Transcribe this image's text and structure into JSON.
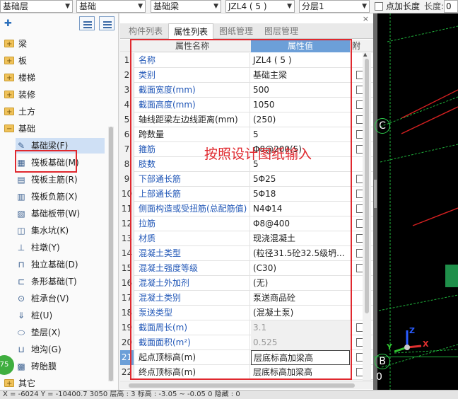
{
  "toolbar": {
    "floor_combo": "基础层",
    "category_combo": "基础",
    "type_combo": "基础梁",
    "member_combo": "JZL4 ( 5 )",
    "layer_combo": "分层1",
    "add_length_label": "点加长度",
    "length_label": "长度:",
    "length_value": "0"
  },
  "tree": {
    "items": [
      {
        "label": "梁",
        "kind": "folder"
      },
      {
        "label": "板",
        "kind": "folder"
      },
      {
        "label": "楼梯",
        "kind": "folder"
      },
      {
        "label": "装修",
        "kind": "folder"
      },
      {
        "label": "土方",
        "kind": "folder"
      },
      {
        "label": "基础",
        "kind": "folder-open"
      },
      {
        "label": "基础梁(F)",
        "kind": "leaf",
        "icon": "pencil-icon",
        "glyph": "✎",
        "selected": true
      },
      {
        "label": "筏板基础(M)",
        "kind": "leaf",
        "icon": "raft-slab-icon",
        "glyph": "▦"
      },
      {
        "label": "筏板主筋(R)",
        "kind": "leaf",
        "icon": "main-rebar-icon",
        "glyph": "▤"
      },
      {
        "label": "筏板负筋(X)",
        "kind": "leaf",
        "icon": "negative-rebar-icon",
        "glyph": "▥"
      },
      {
        "label": "基础板带(W)",
        "kind": "leaf",
        "icon": "slab-strip-icon",
        "glyph": "▧"
      },
      {
        "label": "集水坑(K)",
        "kind": "leaf",
        "icon": "sump-pit-icon",
        "glyph": "◫"
      },
      {
        "label": "柱墩(Y)",
        "kind": "leaf",
        "icon": "pier-icon",
        "glyph": "⊥"
      },
      {
        "label": "独立基础(D)",
        "kind": "leaf",
        "icon": "isolated-footing-icon",
        "glyph": "⊓"
      },
      {
        "label": "条形基础(T)",
        "kind": "leaf",
        "icon": "strip-footing-icon",
        "glyph": "⊏"
      },
      {
        "label": "桩承台(V)",
        "kind": "leaf",
        "icon": "pile-cap-icon",
        "glyph": "⊙"
      },
      {
        "label": "桩(U)",
        "kind": "leaf",
        "icon": "pile-icon",
        "glyph": "⇓"
      },
      {
        "label": "垫层(X)",
        "kind": "leaf",
        "icon": "cushion-icon",
        "glyph": "⬭"
      },
      {
        "label": "地沟(G)",
        "kind": "leaf",
        "icon": "trench-icon",
        "glyph": "⊔"
      },
      {
        "label": "砖胎膜",
        "kind": "leaf",
        "icon": "brick-mold-icon",
        "glyph": "▩"
      },
      {
        "label": "其它",
        "kind": "folder"
      }
    ],
    "badge": "75"
  },
  "tabs": [
    "构件列表",
    "属性列表",
    "图纸管理",
    "图层管理"
  ],
  "grid": {
    "header_name": "属性名称",
    "header_value": "属性值",
    "header_attach": "附",
    "rows": [
      {
        "n": "1",
        "name": "名称",
        "value": "JZL4 ( 5 )",
        "blue": true,
        "check": false
      },
      {
        "n": "2",
        "name": "类别",
        "value": "基础主梁",
        "blue": true,
        "check": true
      },
      {
        "n": "3",
        "name": "截面宽度(mm)",
        "value": "500",
        "blue": true,
        "check": true
      },
      {
        "n": "4",
        "name": "截面高度(mm)",
        "value": "1050",
        "blue": true,
        "check": true
      },
      {
        "n": "5",
        "name": "轴线距梁左边线距离(mm)",
        "value": "(250)",
        "blue": false,
        "check": true
      },
      {
        "n": "6",
        "name": "跨数量",
        "value": "5",
        "blue": false,
        "check": true
      },
      {
        "n": "7",
        "name": "箍筋",
        "value": "Φ8@200(5)",
        "blue": true,
        "check": true
      },
      {
        "n": "8",
        "name": "肢数",
        "value": "5",
        "blue": true,
        "check": false
      },
      {
        "n": "9",
        "name": "下部通长筋",
        "value": "5Φ25",
        "blue": true,
        "check": true
      },
      {
        "n": "10",
        "name": "上部通长筋",
        "value": "5Φ18",
        "blue": true,
        "check": true
      },
      {
        "n": "11",
        "name": "侧面构造或受扭筋(总配筋值)",
        "value": "N4Φ14",
        "blue": true,
        "check": true
      },
      {
        "n": "12",
        "name": "拉筋",
        "value": "Φ8@400",
        "blue": true,
        "check": true
      },
      {
        "n": "13",
        "name": "材质",
        "value": "现浇混凝土",
        "blue": true,
        "check": true
      },
      {
        "n": "14",
        "name": "混凝土类型",
        "value": "(粒径31.5砼32.5级坍...",
        "blue": true,
        "check": true
      },
      {
        "n": "15",
        "name": "混凝土强度等级",
        "value": "(C30)",
        "blue": true,
        "check": true
      },
      {
        "n": "16",
        "name": "混凝土外加剂",
        "value": "(无)",
        "blue": true,
        "check": false
      },
      {
        "n": "17",
        "name": "混凝土类别",
        "value": "泵送商品砼",
        "blue": true,
        "check": false
      },
      {
        "n": "18",
        "name": "泵送类型",
        "value": "(混凝土泵)",
        "blue": true,
        "check": false
      },
      {
        "n": "19",
        "name": "截面周长(m)",
        "value": "3.1",
        "blue": true,
        "check": true,
        "gray": true
      },
      {
        "n": "20",
        "name": "截面面积(m²)",
        "value": "0.525",
        "blue": true,
        "check": true,
        "gray": true
      },
      {
        "n": "21",
        "name": "起点顶标高(m)",
        "value": "层底标高加梁高",
        "blue": false,
        "check": true,
        "boxed": true,
        "hl": true
      },
      {
        "n": "22",
        "name": "终点顶标高(m)",
        "value": "层底标高加梁高",
        "blue": false,
        "check": true
      }
    ]
  },
  "annotation": "按照设计图纸输入",
  "viewport": {
    "axis_c": "C",
    "axis_b": "B",
    "axis_0": "0",
    "x_label": "X",
    "y_label": "Y",
    "z_label": "Z"
  },
  "status": {
    "text": "X = -6024 Y = -10400.7    3050      层高 : 3      标高 : -3.05 ~ -0.05      0     隐藏 : 0"
  },
  "colors": {
    "accent": "#6c9fd8",
    "annotation_red": "#e0282e",
    "grid_green": "#2fcf4f"
  }
}
